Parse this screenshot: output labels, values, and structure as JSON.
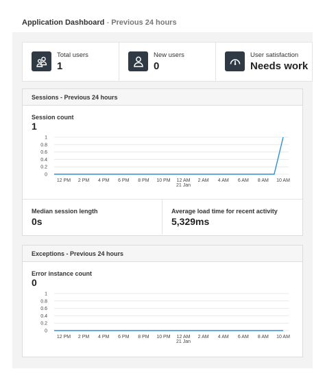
{
  "header": {
    "title": "Application Dashboard",
    "separator": " - ",
    "range": "Previous 24 hours"
  },
  "tiles": [
    {
      "icon": "users-icon",
      "label": "Total users",
      "value": "1"
    },
    {
      "icon": "user-icon",
      "label": "New users",
      "value": "0"
    },
    {
      "icon": "gauge-icon",
      "label": "User satisfaction",
      "value": "Needs work"
    }
  ],
  "sessions": {
    "title": "Sessions - Previous 24 hours",
    "metric_label": "Session count",
    "metric_value": "1",
    "median_label": "Median session length",
    "median_value": "0s",
    "load_label": "Average load time for recent activity",
    "load_value": "5,329ms"
  },
  "exceptions": {
    "title": "Exceptions - Previous 24 hours",
    "metric_label": "Error instance count",
    "metric_value": "0"
  },
  "colors": {
    "accent": "#2b8fd6",
    "icon_bg": "#2f3a45",
    "grid": "#e8e8e8"
  },
  "chart_data": [
    {
      "type": "line",
      "x": [
        "12 PM",
        "2 PM",
        "4 PM",
        "6 PM",
        "8 PM",
        "10 PM",
        "12 AM",
        "2 AM",
        "4 AM",
        "6 AM",
        "8 AM",
        "10 AM"
      ],
      "x_sublabel": {
        "12 AM": "21 Jan"
      },
      "y_ticks": [
        "0",
        "0.2",
        "0.4",
        "0.6",
        "0.8",
        "1"
      ],
      "ylim": [
        0,
        1
      ],
      "series": [
        {
          "values": [
            0,
            0,
            0,
            0,
            0,
            0,
            0,
            0,
            0,
            0,
            0,
            1
          ]
        }
      ]
    },
    {
      "type": "line",
      "x": [
        "12 PM",
        "2 PM",
        "4 PM",
        "6 PM",
        "8 PM",
        "10 PM",
        "12 AM",
        "2 AM",
        "4 AM",
        "6 AM",
        "8 AM",
        "10 AM"
      ],
      "x_sublabel": {
        "12 AM": "21 Jan"
      },
      "y_ticks": [
        "0",
        "0.2",
        "0.4",
        "0.6",
        "0.8",
        "1"
      ],
      "ylim": [
        0,
        1
      ],
      "series": [
        {
          "values": [
            0,
            0,
            0,
            0,
            0,
            0,
            0,
            0,
            0,
            0,
            0,
            0
          ]
        }
      ]
    }
  ]
}
